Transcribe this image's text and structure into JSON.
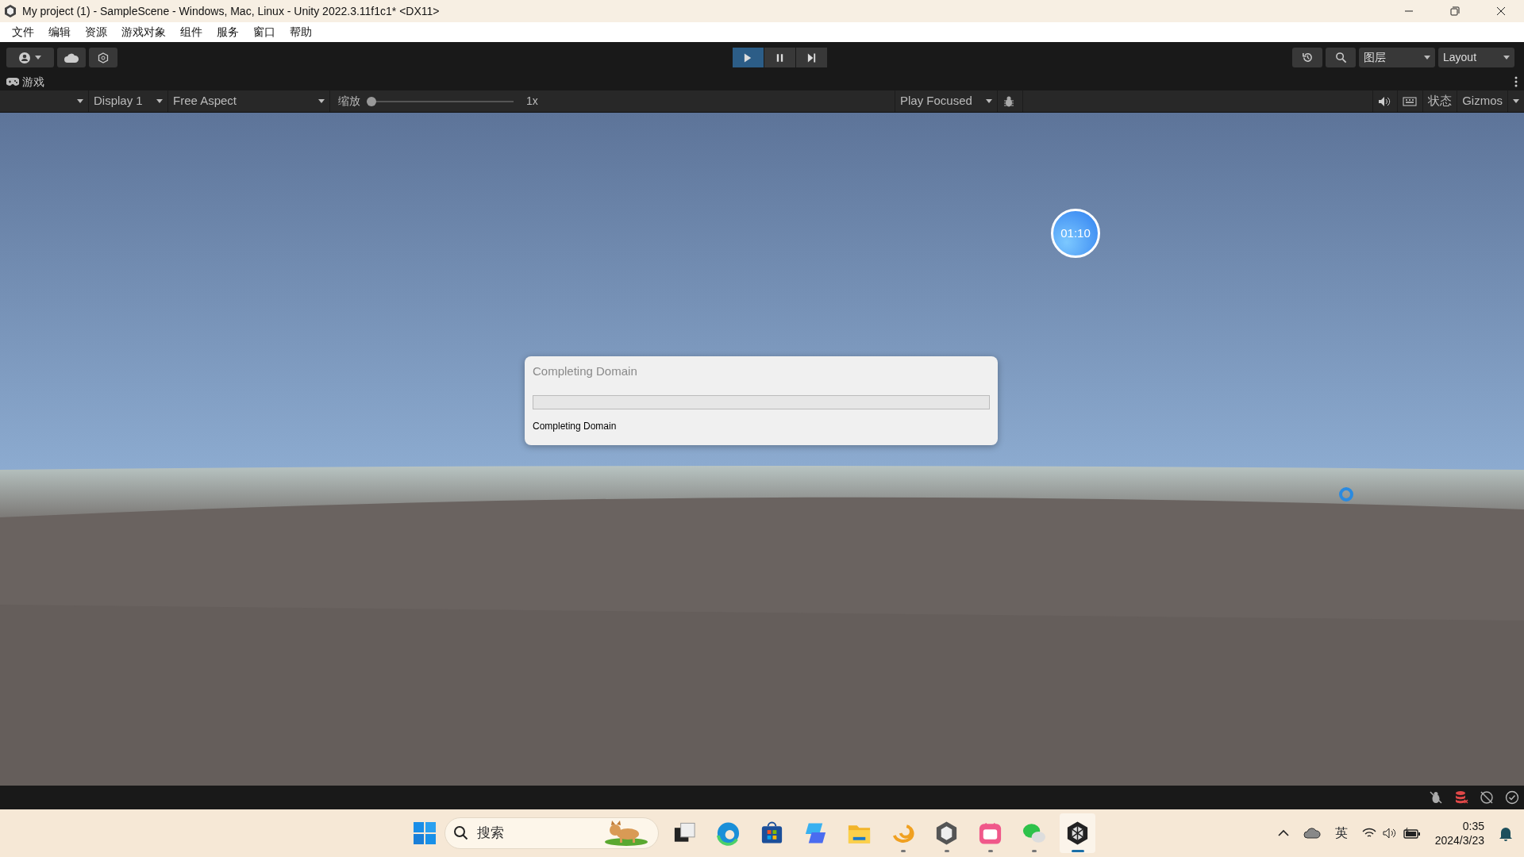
{
  "window": {
    "title": "My project (1) - SampleScene - Windows, Mac, Linux - Unity 2022.3.11f1c1* <DX11>"
  },
  "menu": [
    "文件",
    "编辑",
    "资源",
    "游戏对象",
    "组件",
    "服务",
    "窗口",
    "帮助"
  ],
  "toolbar": {
    "play_controls": [
      {
        "kind": "play",
        "on": true
      },
      {
        "kind": "pause",
        "on": false
      },
      {
        "kind": "step",
        "on": false
      }
    ],
    "layers": "图层",
    "layout": "Layout"
  },
  "game_tab": {
    "label": "游戏"
  },
  "game_toolbar": {
    "display": "Display 1",
    "aspect": "Free Aspect",
    "scale_label": "缩放",
    "scale": {
      "level": 0
    },
    "scale_value": "1x",
    "play_mode": "Play Focused",
    "stats": "状态",
    "gizmos": "Gizmos"
  },
  "timer": "01:10",
  "dialog": {
    "title": "Completing Domain",
    "progress": {
      "level": 0
    },
    "message": "Completing Domain"
  },
  "taskbar": {
    "search": {
      "placeholder": "搜索"
    },
    "apps": [
      {
        "kind": "taskview",
        "running": false,
        "active": false
      },
      {
        "kind": "edge",
        "running": false,
        "active": false
      },
      {
        "kind": "store",
        "running": false,
        "active": false
      },
      {
        "kind": "copilot",
        "running": false,
        "active": false
      },
      {
        "kind": "files",
        "running": false,
        "active": false
      },
      {
        "kind": "swirl",
        "running": true,
        "active": false
      },
      {
        "kind": "unityhub",
        "running": true,
        "active": false
      },
      {
        "kind": "bilibili",
        "running": true,
        "active": false
      },
      {
        "kind": "wechat",
        "running": true,
        "active": false
      },
      {
        "kind": "unity",
        "running": true,
        "active": true
      }
    ]
  },
  "tray": {
    "ime": "英",
    "time": "0:35",
    "date": "2024/3/23"
  }
}
